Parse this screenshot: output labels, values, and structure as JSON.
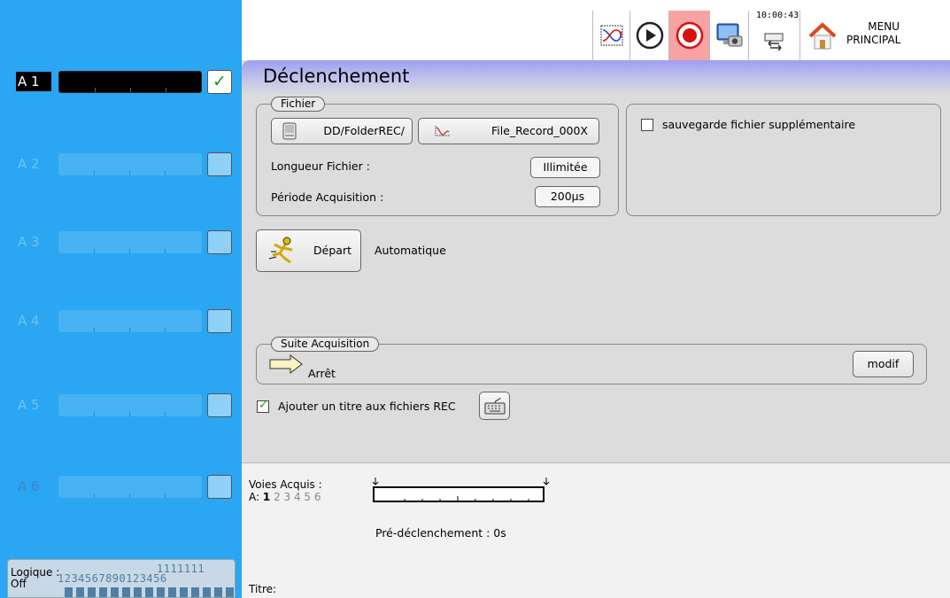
{
  "sidebar": {
    "channels": [
      {
        "label": "A 1",
        "active": true
      },
      {
        "label": "A 2",
        "active": false
      },
      {
        "label": "A 3",
        "active": false
      },
      {
        "label": "A 4",
        "active": false
      },
      {
        "label": "A 5",
        "active": false
      },
      {
        "label": "A 6",
        "active": false
      }
    ],
    "logic": {
      "label_line1": "Logique :",
      "label_line2": "Off",
      "numbers_row1": "1111111",
      "numbers_row2": "1234567890123456"
    }
  },
  "toolbar": {
    "clock": "10:00:43",
    "menu_line1": "MENU",
    "menu_line2": "PRINCIPAL",
    "icons": [
      "waveform-icon",
      "play-icon",
      "record-icon",
      "monitor-camera-icon",
      "usb-transfer-icon",
      "home-icon"
    ]
  },
  "main": {
    "title": "Déclenchement",
    "fichier": {
      "legend": "Fichier",
      "folder_btn": "DD/FolderREC/",
      "file_btn": "File_Record_000X",
      "length_label": "Longueur Fichier :",
      "length_value": "Illimitée",
      "period_label": "Période Acquisition :",
      "period_value": "200µs"
    },
    "extra_save_label": "sauvegarde fichier supplémentaire",
    "start_btn": "Départ",
    "start_mode": "Automatique",
    "suite": {
      "legend": "Suite Acquisition",
      "value": "Arrêt",
      "modif_btn": "modif"
    },
    "add_title_label": "Ajouter un titre aux fichiers REC"
  },
  "bottom": {
    "voies_label": "Voies Acquis :",
    "voies_prefix": "A:",
    "voies_active": "1",
    "voies_inactive": "2 3 4 5 6",
    "pre_trigger": "Pré-déclenchement : 0s",
    "title_label": "Titre:"
  },
  "colors": {
    "sidebar": "#2aa6f2",
    "record_active": "#f7a3a3",
    "header_gradient": "#9d9ff0"
  }
}
